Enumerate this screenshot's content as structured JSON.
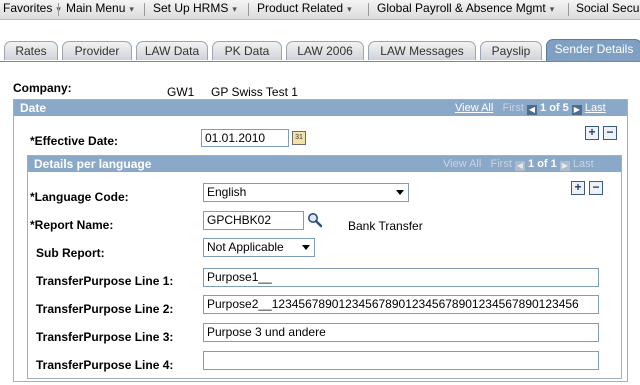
{
  "menubar": {
    "items": [
      {
        "label": "Favorites",
        "chevron": "chevron-down-icon"
      },
      {
        "label": "Main Menu",
        "chevron": "chevron-down-icon"
      },
      {
        "label": "Set Up HRMS",
        "chevron": "chevron-down-icon"
      },
      {
        "label": "Product Related",
        "chevron": "chevron-down-icon"
      },
      {
        "label": "Global Payroll & Absence Mgmt",
        "chevron": "chevron-down-icon"
      },
      {
        "label": "Social Secu"
      }
    ],
    "chevron_glyph": "▾"
  },
  "tabs": [
    {
      "label": "Rates"
    },
    {
      "label": "Provider"
    },
    {
      "label": "LAW Data"
    },
    {
      "label": "PK Data"
    },
    {
      "label": "LAW 2006"
    },
    {
      "label": "LAW Messages"
    },
    {
      "label": "Payslip"
    },
    {
      "label": "Sender Details",
      "active": true
    }
  ],
  "company": {
    "label": "Company:",
    "code": "GW1",
    "name": "GP Swiss Test 1"
  },
  "date_group": {
    "title": "Date",
    "view_all": "View All",
    "first": "First",
    "count": "1 of 5",
    "last": "Last",
    "effective_date_label": "*Effective Date:",
    "effective_date_value": "01.01.2010",
    "calendar_glyph": "31"
  },
  "lang_group": {
    "title": "Details per language",
    "view_all": "View All",
    "first": "First",
    "count": "1 of 1",
    "last": "Last",
    "language_label": "*Language Code:",
    "language_value": "English",
    "report_label": "*Report Name:",
    "report_value": "GPCHBK02",
    "report_desc": "Bank Transfer",
    "subreport_label": "Sub Report:",
    "subreport_value": "Not Applicable",
    "line1_label": "TransferPurpose Line 1:",
    "line1_value": "Purpose1__",
    "line2_label": "TransferPurpose Line 2:",
    "line2_value": "Purpose2__1234567890123456789012345678901234567890123456",
    "line3_label": "TransferPurpose Line 3:",
    "line3_value": "Purpose 3 und andere",
    "line4_label": "TransferPurpose Line 4:",
    "line4_value": ""
  },
  "glyphs": {
    "plus": "+",
    "minus": "−",
    "prev": "◀",
    "next": "▶"
  },
  "colors": {
    "group_header": "#8aa8c7",
    "active_tab": "#7fa0c2",
    "link": "#1f3f7a"
  }
}
